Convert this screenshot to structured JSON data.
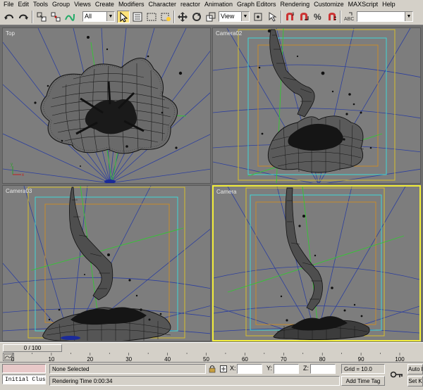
{
  "menu": [
    "File",
    "Edit",
    "Tools",
    "Group",
    "Views",
    "Create",
    "Modifiers",
    "Character",
    "reactor",
    "Animation",
    "Graph Editors",
    "Rendering",
    "Customize",
    "MAXScript",
    "Help"
  ],
  "toolbar": {
    "selection_filter": "All",
    "reference_coord": "View",
    "named_selection": ""
  },
  "viewports": {
    "top": "Top",
    "camera02": "Camera02",
    "camera03": "Camera03",
    "camera": "Camera"
  },
  "timeline": {
    "frame_counter": "0 / 100",
    "ticks": [
      "0",
      "10",
      "20",
      "30",
      "40",
      "50",
      "60",
      "70",
      "80",
      "90",
      "100"
    ]
  },
  "status": {
    "maxscript_listener": "Initial Clust",
    "selection_status": "None Selected",
    "prompt": "Rendering Time  0:00:34",
    "x_label": "X:",
    "y_label": "Y:",
    "z_label": "Z:",
    "x_value": "",
    "y_value": "",
    "z_value": "",
    "grid": "Grid = 10.0",
    "add_time_tag": "Add Time Tag",
    "auto_key": "Auto K",
    "set_key": "Set K"
  },
  "colors": {
    "viewport_bg": "#7d7d7d",
    "active_border": "#f2ee3b",
    "camera_frame_yellow": "#d8c02a",
    "camera_frame_cyan": "#3fd6d6",
    "camera_frame_orange": "#c88a2a",
    "grid_blue": "#2c3f9e",
    "grid_green": "#32c832"
  }
}
